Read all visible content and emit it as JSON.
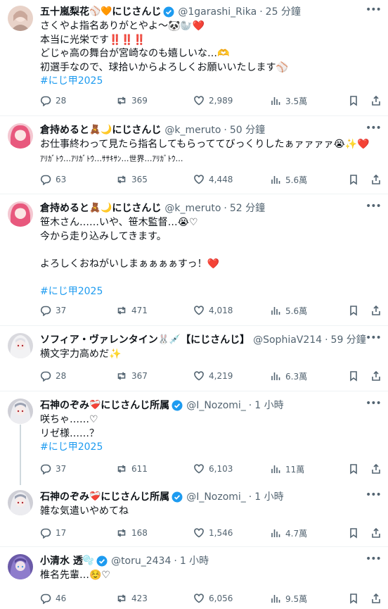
{
  "colors": {
    "accent": "#1d9bf0",
    "text": "#0f1419",
    "muted": "#536471",
    "verified": "#1d9bf0"
  },
  "tweets": [
    {
      "name": "五十嵐梨花",
      "name_emoji": "⚾🧡",
      "name_suffix": "にじさんじ",
      "handle": "@1garashi_Rika",
      "time": "25 分鐘",
      "lines": [
        "さくやよ指名ありがとやよ〜🐼🦭❤️",
        "本当に光栄です‼️‼️‼️",
        "どじゃ高の舞台が宮崎なのも嬉しいな…🫶",
        "初選手なので、球拾いからよろしくお願いいたします⚾"
      ],
      "hashtag": "#にじ甲2025",
      "stats": {
        "replies": "28",
        "reposts": "369",
        "likes": "2,989",
        "views": "3.5萬"
      }
    },
    {
      "name": "倉持めると",
      "name_emoji": "🧸🌙",
      "name_suffix": "にじさんじ",
      "handle": "@k_meruto",
      "time": "50 分鐘",
      "lines": [
        "お仕事終わって見たら指名してもらっててびっくりしたぁァァァァ😭✨❤️",
        "ｱﾘｶﾞﾄｳ…ｱﾘｶﾞﾄｳ…ｻｻｷｻﾝ…世界…ｱﾘｶﾞﾄｳ…"
      ],
      "hashtag": "",
      "stats": {
        "replies": "63",
        "reposts": "365",
        "likes": "4,448",
        "views": "5.6萬"
      }
    },
    {
      "name": "倉持めると",
      "name_emoji": "🧸🌙",
      "name_suffix": "にじさんじ",
      "handle": "@k_meruto",
      "time": "52 分鐘",
      "lines": [
        "笹木さん……いや、笹木監督…😭♡",
        "今から走り込みしてきます。",
        "",
        "よろしくおねがいしまぁぁぁぁすっ！❤️",
        ""
      ],
      "hashtag": "#にじ甲2025",
      "stats": {
        "replies": "37",
        "reposts": "471",
        "likes": "4,018",
        "views": "5.6萬"
      }
    },
    {
      "name": "ソフィア・ヴァレンタイン",
      "name_emoji": "🐰💉",
      "name_suffix": "【にじさんじ】",
      "handle": "@SophiaV214",
      "time": "59 分鐘",
      "lines": [
        "横文字力高めだ✨"
      ],
      "hashtag": "",
      "stats": {
        "replies": "28",
        "reposts": "367",
        "likes": "4,219",
        "views": "6.3萬"
      }
    },
    {
      "name": "石神のぞみ",
      "name_emoji": "❤️‍🩹",
      "name_suffix": "にじさんじ所属",
      "handle": "@I_Nozomi_",
      "time": "1 小時",
      "lines": [
        "咲ちゃ……♡",
        "リゼ様……？"
      ],
      "hashtag": "#にじ甲2025",
      "stats": {
        "replies": "37",
        "reposts": "611",
        "likes": "6,103",
        "views": "11萬"
      }
    },
    {
      "name": "石神のぞみ",
      "name_emoji": "❤️‍🩹",
      "name_suffix": "にじさんじ所属",
      "handle": "@I_Nozomi_",
      "time": "1 小時",
      "lines": [
        "雑な気遣いやめてね"
      ],
      "hashtag": "",
      "stats": {
        "replies": "17",
        "reposts": "168",
        "likes": "1,546",
        "views": "4.7萬"
      }
    },
    {
      "name": "小清水 透",
      "name_emoji": "🫧",
      "name_suffix": "",
      "handle": "@toru_2434",
      "time": "1 小時",
      "lines": [
        "椎名先輩…☺️♡"
      ],
      "hashtag": "",
      "stats": {
        "replies": "46",
        "reposts": "423",
        "likes": "6,056",
        "views": "9.5萬"
      }
    }
  ]
}
